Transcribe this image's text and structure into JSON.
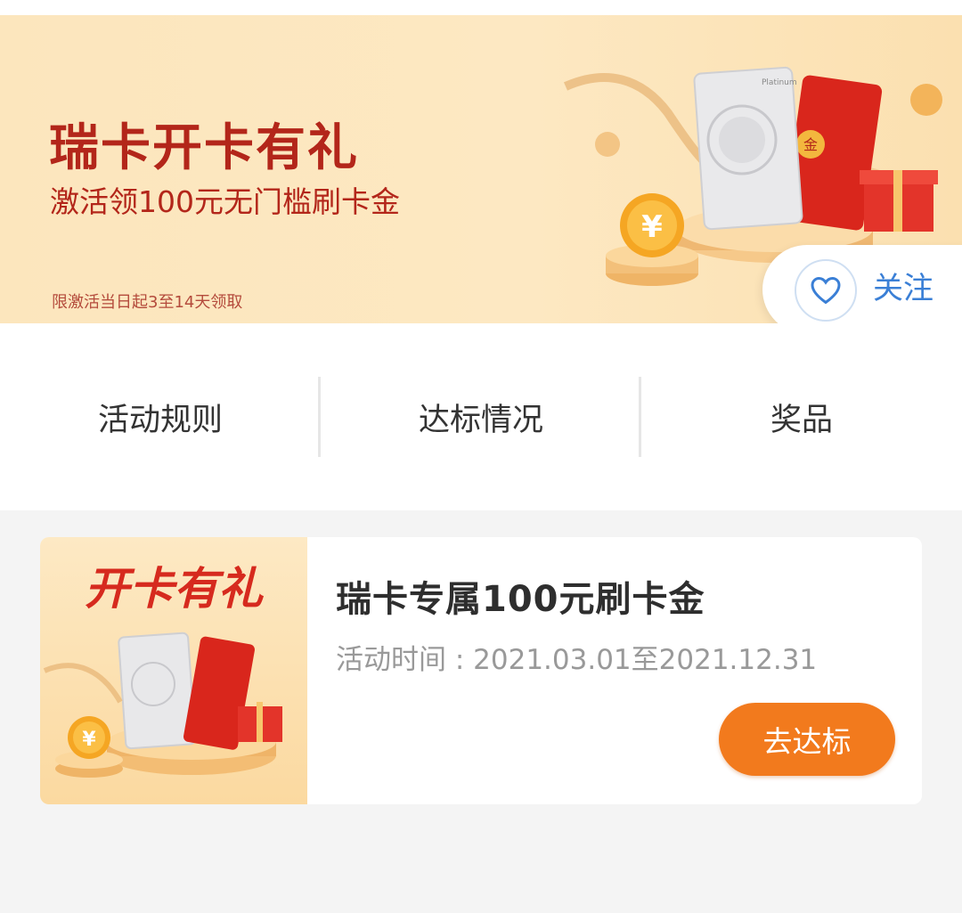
{
  "banner": {
    "title": "瑞卡开卡有礼",
    "subtitle": "激活领100元无门槛刷卡金",
    "note": "限激活当日起3至14天领取",
    "follow_label": "关注",
    "card_small_text": "Platinum",
    "coin_symbol": "¥",
    "envelope_symbol": "金"
  },
  "tabs": [
    {
      "label": "活动规则"
    },
    {
      "label": "达标情况"
    },
    {
      "label": "奖品"
    }
  ],
  "prize_card": {
    "thumb_title": "开卡有礼",
    "title": "瑞卡专属100元刷卡金",
    "time_label": "活动时间 : 2021.03.01至2021.12.31",
    "button_label": "去达标",
    "coin_symbol": "¥"
  },
  "colors": {
    "brand_red": "#b3261a",
    "follow_blue": "#3a7fd6",
    "button_orange": "#f27a1d"
  }
}
